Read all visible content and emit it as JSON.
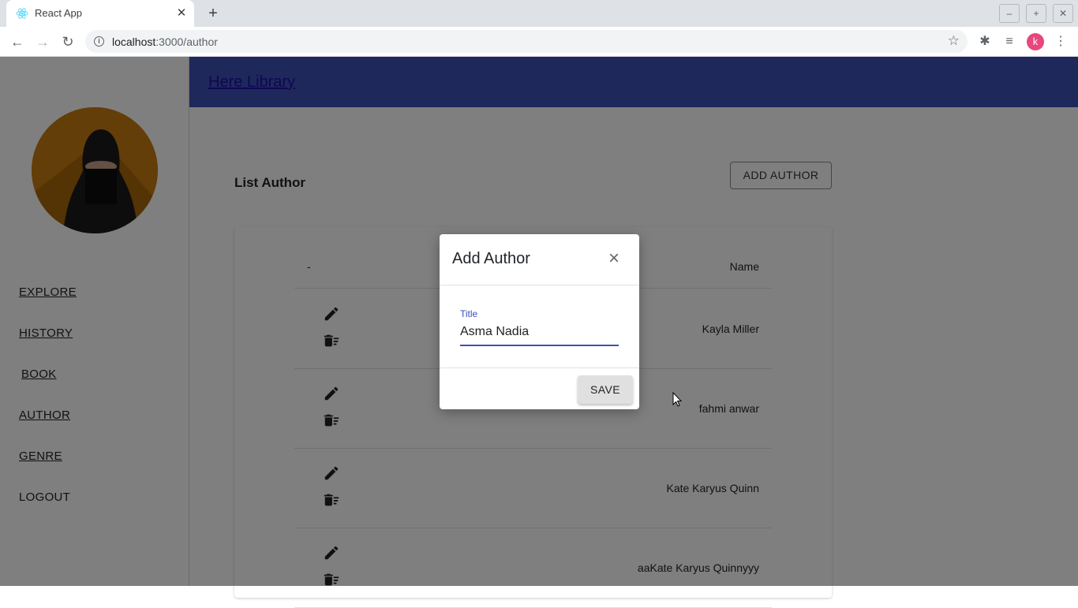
{
  "browser": {
    "tab_title": "React App",
    "url_host": "localhost",
    "url_path": ":3000/author",
    "profile_initial": "k"
  },
  "sidebar": {
    "items": [
      {
        "label": "EXPLORE"
      },
      {
        "label": "HISTORY"
      },
      {
        "label": "BOOK"
      },
      {
        "label": "AUTHOR"
      },
      {
        "label": "GENRE"
      },
      {
        "label": "LOGOUT"
      }
    ]
  },
  "header": {
    "brand": "Here Library"
  },
  "main": {
    "title": "List Author",
    "add_button": "ADD AUTHOR",
    "table": {
      "headers": [
        "-",
        "Name"
      ],
      "rows": [
        {
          "name": "Kayla Miller"
        },
        {
          "name": "fahmi anwar"
        },
        {
          "name": "Kate Karyus Quinn"
        },
        {
          "name": "aaKate Karyus Quinnyyy"
        }
      ]
    }
  },
  "modal": {
    "title": "Add Author",
    "field_label": "Title",
    "field_value": "Asma Nadia",
    "save_label": "SAVE"
  }
}
